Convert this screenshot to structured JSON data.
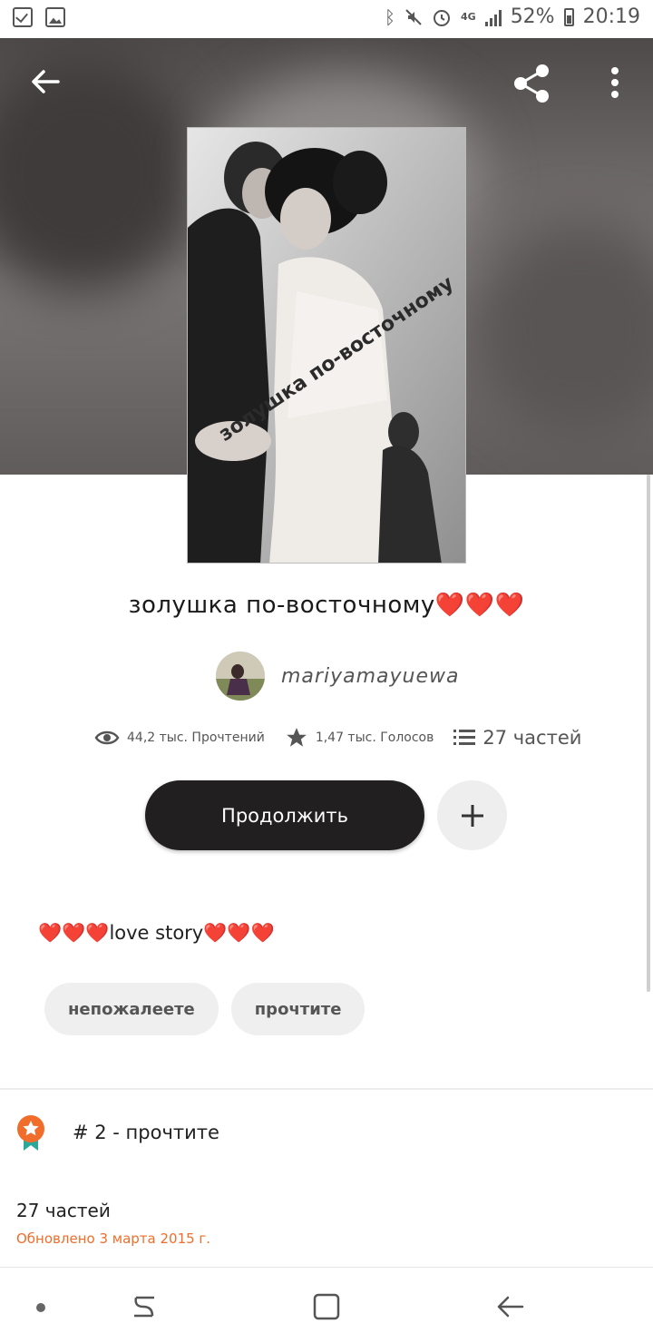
{
  "status_bar": {
    "network": "4G",
    "battery": "52%",
    "time": "20:19",
    "icons": [
      "checklist-icon",
      "gallery-icon",
      "bluetooth-icon",
      "mute-icon",
      "alarm-icon",
      "signal-icon",
      "battery-icon"
    ]
  },
  "header": {
    "back_icon": "arrow-left-icon",
    "share_icon": "share-icon",
    "menu_icon": "more-vertical-icon"
  },
  "cover": {
    "caption": "золушка по-восточному"
  },
  "story": {
    "title": "золушка по-восточному❤️❤️❤️",
    "author": "mariyamayuewa"
  },
  "stats": {
    "reads": "44,2 тыс. Прочтений",
    "votes": "1,47 тыс. Голосов",
    "parts": "27 частей"
  },
  "actions": {
    "continue_label": "Продолжить",
    "add_icon": "plus-icon"
  },
  "description": "❤️❤️❤️love story❤️❤️❤️",
  "tags": [
    "непожалеете",
    "прочтите"
  ],
  "ranking": {
    "text": "# 2 - прочтите",
    "icon": "ranking-badge-icon"
  },
  "parts_info": {
    "count": "27 частей",
    "updated": "Обновлено 3 марта 2015 г."
  },
  "colors": {
    "accent": "#f06d2b",
    "dark_button": "#221f20",
    "header_bg": "#6b6666"
  }
}
